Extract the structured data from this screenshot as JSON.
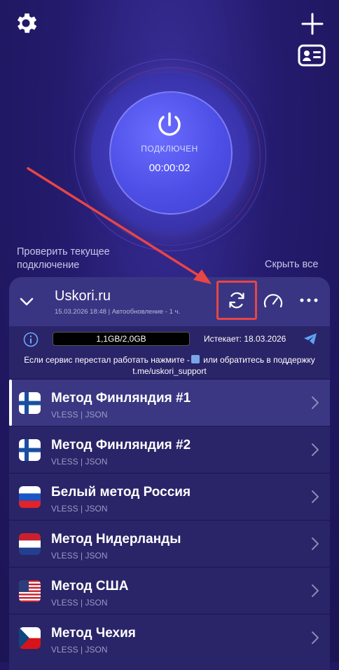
{
  "app": {
    "status": "ПОДКЛЮЧЕН",
    "timer": "00:00:02",
    "check_connection": "Проверить текущее подключение",
    "hide_all": "Скрыть все"
  },
  "subscription": {
    "name": "Uskori.ru",
    "meta": "15.03.2026 18:48 | Автообновление - 1 ч.",
    "traffic": "1,1GB/2,0GB",
    "traffic_fraction": 0.55,
    "expires": "Истекает: 18.03.2026",
    "notice_line1_a": "Если сервис перестал работать нажмите -",
    "notice_line1_b": "или обратитесь в поддержку",
    "notice_line2": "t.me/uskori_support"
  },
  "servers": [
    {
      "name": "Метод Финляндия #1",
      "protocol": "VLESS | JSON",
      "flag": "finland",
      "active": true
    },
    {
      "name": "Метод Финляндия #2",
      "protocol": "VLESS | JSON",
      "flag": "finland",
      "active": false
    },
    {
      "name": "Белый метод Россия",
      "protocol": "VLESS | JSON",
      "flag": "russia",
      "active": false
    },
    {
      "name": "Метод Нидерланды",
      "protocol": "VLESS | JSON",
      "flag": "netherlands",
      "active": false
    },
    {
      "name": "Метод США",
      "protocol": "VLESS | JSON",
      "flag": "usa",
      "active": false
    },
    {
      "name": "Метод Чехия",
      "protocol": "VLESS | JSON",
      "flag": "czech",
      "active": false
    }
  ],
  "colors": {
    "accent": "#4e4fe6",
    "highlight": "#e84545",
    "panel": "#2a2468"
  }
}
